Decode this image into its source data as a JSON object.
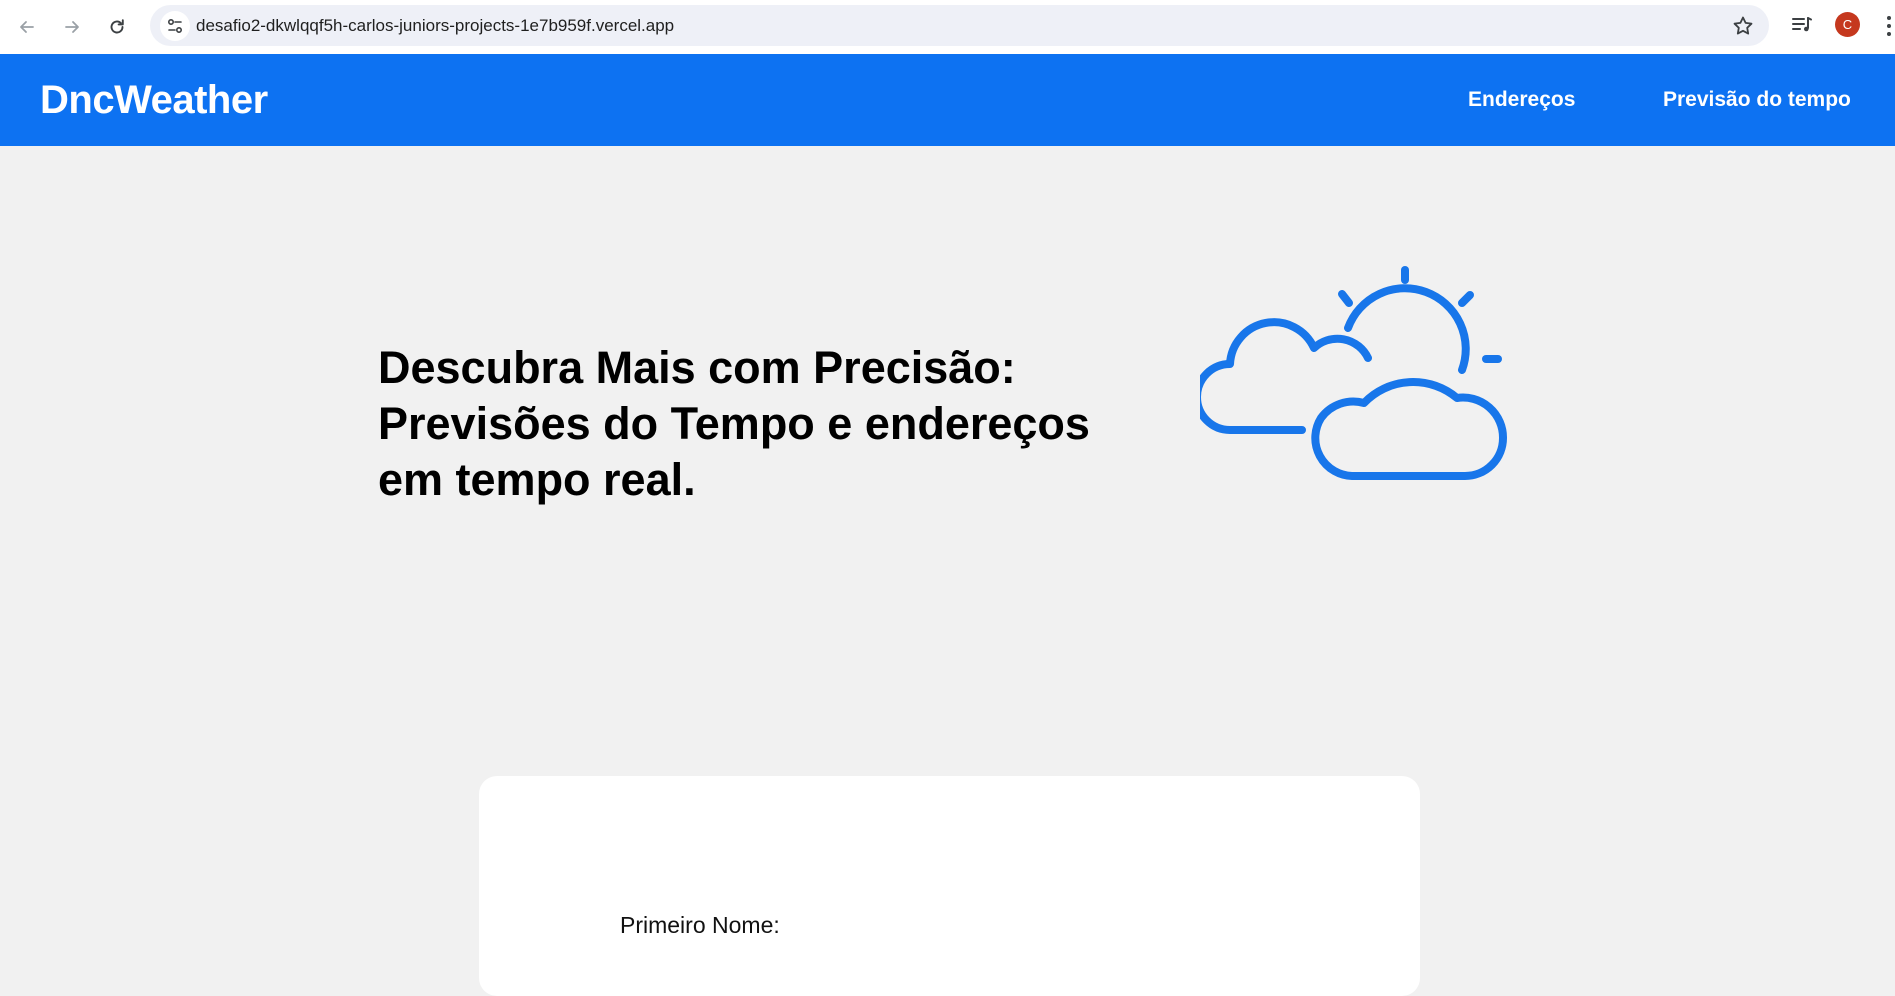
{
  "browser": {
    "url": "desafio2-dkwlqqf5h-carlos-juniors-projects-1e7b959f.vercel.app",
    "profile_initial": "C",
    "profile_color": "#c5381e"
  },
  "header": {
    "brand": "DncWeather",
    "nav": [
      {
        "label": "Endereços"
      },
      {
        "label": "Previsão do tempo"
      }
    ],
    "background_color": "#0d72f2"
  },
  "hero": {
    "title": "Descubra Mais com Precisão:\nPrevisões do Tempo e endereços\nem tempo real.",
    "icon": "partly-cloudy-icon",
    "icon_color": "#1876ea"
  },
  "form": {
    "first_name_label": "Primeiro Nome:"
  }
}
